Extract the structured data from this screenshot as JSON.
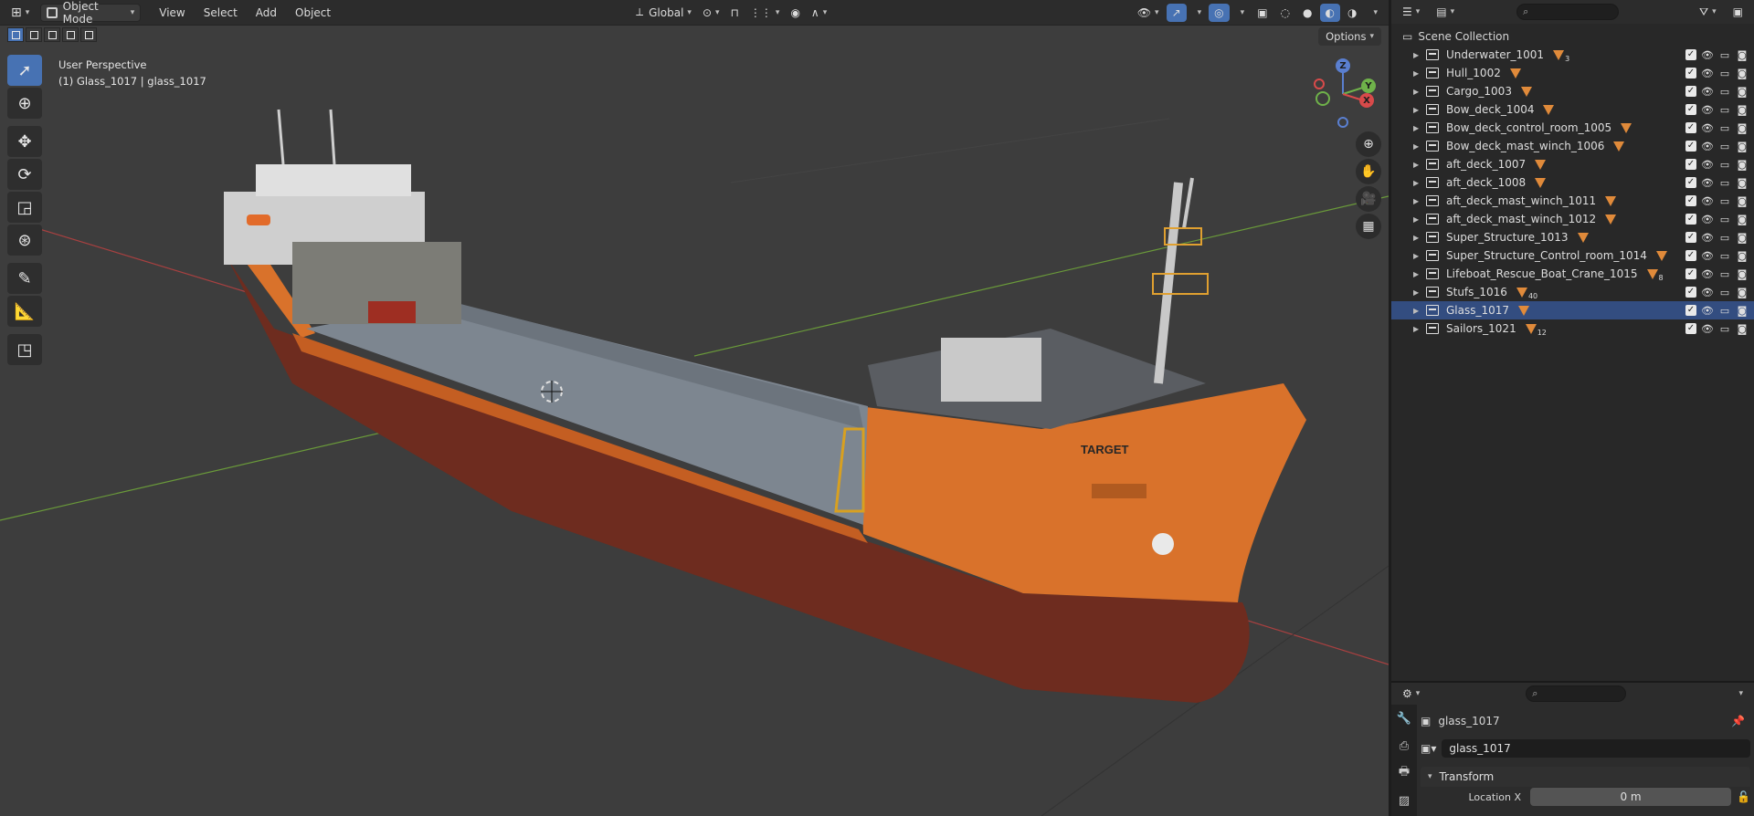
{
  "viewport": {
    "mode": "Object Mode",
    "menus": [
      "View",
      "Select",
      "Add",
      "Object"
    ],
    "orientation": "Global",
    "options_label": "Options",
    "perspective": "User Perspective",
    "active_object": "(1) Glass_1017 | glass_1017",
    "ship_text": "TARGET",
    "gizmo": {
      "z": "Z",
      "y": "Y",
      "x": "X"
    }
  },
  "outliner": {
    "scene_collection": "Scene Collection",
    "items": [
      {
        "label": "Underwater_1001",
        "count": "3"
      },
      {
        "label": "Hull_1002",
        "count": ""
      },
      {
        "label": "Cargo_1003",
        "count": ""
      },
      {
        "label": "Bow_deck_1004",
        "count": ""
      },
      {
        "label": "Bow_deck_control_room_1005",
        "count": ""
      },
      {
        "label": "Bow_deck_mast_winch_1006",
        "count": ""
      },
      {
        "label": "aft_deck_1007",
        "count": ""
      },
      {
        "label": "aft_deck_1008",
        "count": ""
      },
      {
        "label": "aft_deck_mast_winch_1011",
        "count": ""
      },
      {
        "label": "aft_deck_mast_winch_1012",
        "count": ""
      },
      {
        "label": "Super_Structure_1013",
        "count": ""
      },
      {
        "label": "Super_Structure_Control_room_1014",
        "count": ""
      },
      {
        "label": "Lifeboat_Rescue_Boat_Crane_1015",
        "count": "8"
      },
      {
        "label": "Stufs_1016",
        "count": "40"
      },
      {
        "label": "Glass_1017",
        "count": ""
      },
      {
        "label": "Sailors_1021",
        "count": "12"
      }
    ]
  },
  "properties": {
    "object_name": "glass_1017",
    "data_name": "glass_1017",
    "panel": "Transform",
    "location_x_label": "Location X",
    "location_x_value": "0 m"
  },
  "colors": {
    "accent": "#4772b3",
    "mesh_icon": "#e08a3a",
    "hull_orange": "#d9722b",
    "hull_rust": "#6e2c1f",
    "viewport_bg": "#3d3d3d"
  }
}
